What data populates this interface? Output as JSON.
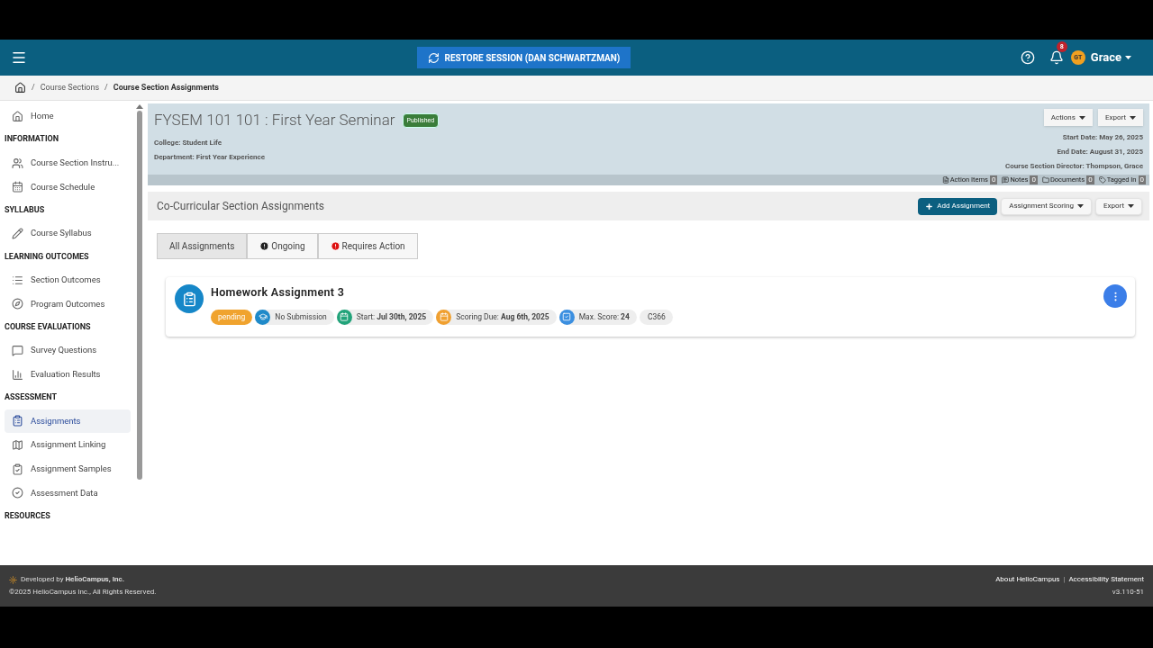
{
  "topbar": {
    "restore_button": "RESTORE SESSION (DAN SCHWARTZMAN)",
    "notification_count": "8",
    "avatar_initials": "GT",
    "user_name": "Grace"
  },
  "breadcrumbs": [
    {
      "separator": "/",
      "label": "Course Sections",
      "current": false
    },
    {
      "separator": "/",
      "label": "Course Section Assignments",
      "current": true
    }
  ],
  "sidebar": [
    {
      "items": [
        {
          "label": "Home",
          "selected": false
        }
      ]
    },
    {
      "heading": "INFORMATION",
      "items": [
        {
          "label": "Course Section Instru...",
          "selected": false
        },
        {
          "label": "Course Schedule",
          "selected": false
        }
      ]
    },
    {
      "heading": "SYLLABUS",
      "items": [
        {
          "label": "Course Syllabus",
          "selected": false
        }
      ]
    },
    {
      "heading": "LEARNING OUTCOMES",
      "items": [
        {
          "label": "Section Outcomes",
          "selected": false
        },
        {
          "label": "Program Outcomes",
          "selected": false
        }
      ]
    },
    {
      "heading": "COURSE EVALUATIONS",
      "items": [
        {
          "label": "Survey Questions",
          "selected": false
        },
        {
          "label": "Evaluation Results",
          "selected": false
        }
      ]
    },
    {
      "heading": "ASSESSMENT",
      "items": [
        {
          "label": "Assignments",
          "selected": true
        },
        {
          "label": "Assignment Linking",
          "selected": false
        },
        {
          "label": "Assignment Samples",
          "selected": false
        },
        {
          "label": "Assessment Data",
          "selected": false
        }
      ]
    },
    {
      "heading": "RESOURCES"
    }
  ],
  "course": {
    "title": "FYSEM 101 101 : First Year Seminar",
    "status": "Published",
    "college": "College: Student Life",
    "department": "Department: First Year Experience",
    "buttons": [
      "Actions",
      "Export"
    ],
    "start_date": "Start Date: May 26, 2025",
    "end_date": "End Date: August 31, 2025",
    "director": "Course Section Director: Thompson, Grace",
    "counters": [
      {
        "label": "Action Items",
        "count": "0"
      },
      {
        "label": "Notes",
        "count": "0"
      },
      {
        "label": "Documents",
        "count": "0"
      },
      {
        "label": "Tagged In",
        "count": "0"
      }
    ]
  },
  "section": {
    "title": "Co-Curricular Section Assignments",
    "add_button": "Add Assignment",
    "buttons": [
      "Assignment Scoring",
      "Export"
    ],
    "tabs": [
      {
        "label": "All Assignments",
        "selected": true,
        "kind": "plain"
      },
      {
        "label": "Ongoing",
        "selected": false,
        "kind": "info"
      },
      {
        "label": "Requires Action",
        "selected": false,
        "kind": "alert"
      }
    ],
    "assignments": [
      {
        "title": "Homework Assignment 3",
        "status": "pending",
        "chips": [
          {
            "kind": "submission",
            "color": "#1f8ac9",
            "text": "No Submission"
          },
          {
            "kind": "start",
            "color": "#22a37a",
            "text": "Start: **Jul 30th, 2025**"
          },
          {
            "kind": "due",
            "color": "#f0a030",
            "text": "Scoring Due: **Aug 6th, 2025**"
          },
          {
            "kind": "score",
            "color": "#3b8fe0",
            "text": "Max. Score: **24**"
          },
          {
            "kind": "code",
            "text": "C366"
          }
        ]
      }
    ]
  },
  "footer": {
    "developed_by": "Developed by **HelioCampus, Inc.**",
    "copyright": "©2025 HelioCampus Inc., All Rights Reserved.",
    "links": [
      "About HelioCampus",
      "Accessibility Statement"
    ],
    "link_separator": "|",
    "version": "v3.110-51"
  }
}
